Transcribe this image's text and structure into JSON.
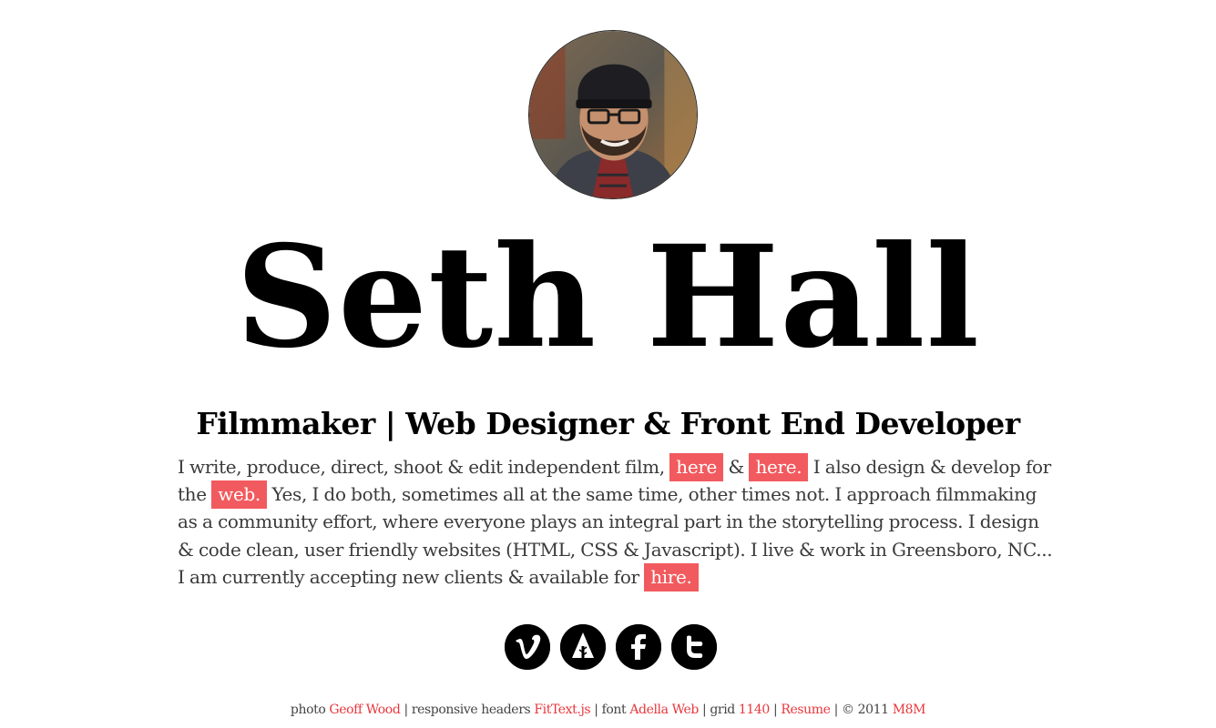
{
  "header": {
    "name": "Seth Hall",
    "tagline": "Filmmaker | Web Designer & Front End Developer"
  },
  "bio": {
    "part1": "I write, produce, direct, shoot & edit independent film, ",
    "link_here1": "here",
    "amp": " & ",
    "link_here2": "here.",
    "part2": " I also design & develop for the ",
    "link_web": "web.",
    "part3": " Yes, I do both, sometimes all at the same time, other times not. I approach filmmaking as a community effort, where everyone plays an integral part in the storytelling process. I design & code clean, user friendly websites (HTML, CSS & Javascript). I live & work in Greensboro, NC... I am currently accepting new clients & available for ",
    "link_hire": "hire."
  },
  "social": [
    {
      "name": "vimeo",
      "icon": "vimeo-icon"
    },
    {
      "name": "forrst",
      "icon": "forrst-icon"
    },
    {
      "name": "facebook",
      "icon": "facebook-icon"
    },
    {
      "name": "twitter",
      "icon": "twitter-icon"
    }
  ],
  "footer": {
    "photo_label": "photo ",
    "photo_link": "Geoff Wood",
    "sep1": " | responsive headers ",
    "headers_link": "FitText.js",
    "sep2": " | font ",
    "font_link": "Adella Web",
    "sep3": " | grid ",
    "grid_link": "1140",
    "sep4": " | ",
    "resume_link": "Resume",
    "sep5": " | © 2011 ",
    "m8m_link": "M8M"
  },
  "colors": {
    "accent": "#f15a5e",
    "link": "#e8373c",
    "text": "#3a3a3a",
    "heading": "#000000"
  }
}
